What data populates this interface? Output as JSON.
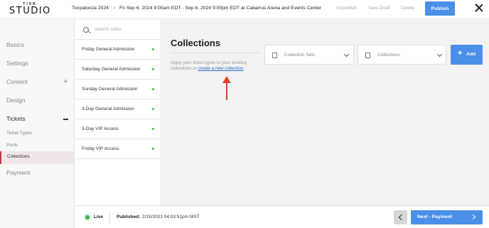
{
  "header": {
    "logo_top": "TIXR",
    "logo_main": "STUDIO",
    "event_name": "Tixrpalooza 2024",
    "breadcrumb_sep": ">",
    "event_dates": "Fri Sep 6, 2024 9:00am EDT - Sep 8, 2024 9:00pm EDT at Cabarrus Arena and Events Center",
    "unpublish_label": "Unpublish",
    "save_draft_label": "Save Draft",
    "delete_label": "Delete",
    "publish_label": "Publish"
  },
  "leftnav": {
    "basics": "Basics",
    "settings": "Settings",
    "content": "Content",
    "design": "Design",
    "tickets": "Tickets",
    "ticket_types": "Ticket Types",
    "pools": "Pools",
    "collections": "Collections",
    "payment": "Payment"
  },
  "sales": {
    "search_placeholder": "Search sales",
    "items": [
      {
        "label": "Friday General Admission"
      },
      {
        "label": "Saturday General Admission"
      },
      {
        "label": "Sunday General Admission"
      },
      {
        "label": "3-Day General Admission"
      },
      {
        "label": "3-Day VIP Access"
      },
      {
        "label": "Friday VIP Access"
      }
    ]
  },
  "main": {
    "title": "Collections",
    "help_text": "Apply your ticket types to your existing collections or",
    "help_link": "create a new collection",
    "help_end": ".",
    "collection_sets_label": "Collection Sets",
    "collections_label": "Collections",
    "add_label": "Add"
  },
  "footer": {
    "live_label": "Live",
    "published_label": "Published:",
    "published_value": "2/15/2023 04:03:51pm MST",
    "next_label": "Next - Payment"
  },
  "colors": {
    "accent": "#4a90e8",
    "live": "#3cb84a",
    "annotation_arrow": "#e0452f",
    "active_marker": "#c0354a"
  }
}
